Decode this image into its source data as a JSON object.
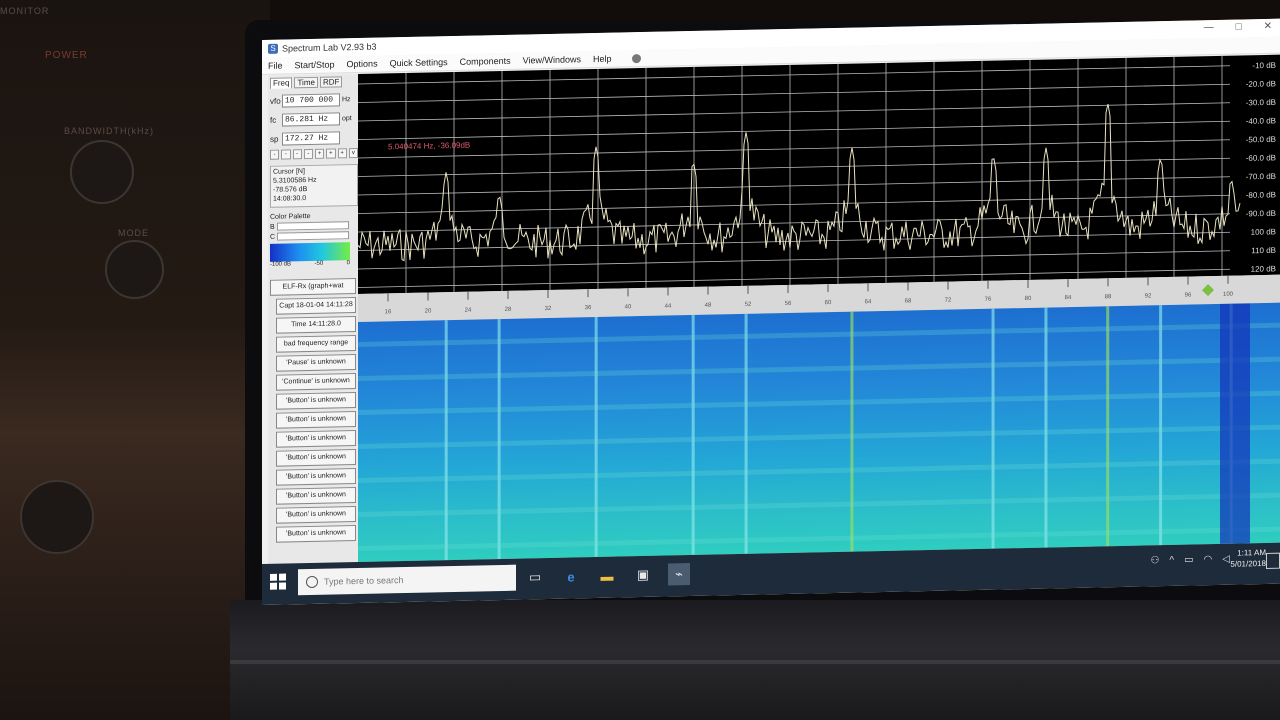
{
  "window": {
    "title": "Spectrum Lab V2.93 b3",
    "controls": [
      "—",
      "□",
      "✕"
    ]
  },
  "menu": [
    "File",
    "Start/Stop",
    "Options",
    "Quick Settings",
    "Components",
    "View/Windows",
    "Help"
  ],
  "panel": {
    "tabs": [
      "Freq",
      "Time",
      "RDF"
    ],
    "vfo": {
      "label": "vfo",
      "value": "10 700 000",
      "unit": "Hz"
    },
    "fc": {
      "label": "fc",
      "value": "86.281 Hz",
      "unit": "opt"
    },
    "sp": {
      "label": "sp",
      "value": "172.27 Hz"
    },
    "stepper": [
      "-",
      "-",
      "-",
      "-",
      "+",
      "+",
      "+",
      "v"
    ],
    "cursor_title": "Cursor [N]",
    "cursor_freq": "5.3100586 Hz",
    "cursor_db": "-78.576 dB",
    "cursor_time": "14:08:30.0",
    "palette_title": "Color Palette",
    "palette_b": "B",
    "palette_c": "C",
    "palette_scale": [
      "-100 dB",
      "-50",
      "0"
    ],
    "buttons": [
      "ELF-Rx (graph+wat",
      "Capt 18-01-04 14:11:28",
      "Time  14:11:28.0",
      "bad frequency range",
      "'Pause' is unknown",
      "'Continue' is unknown",
      "'Button' is unknown",
      "'Button' is unknown",
      "'Button' is unknown",
      "'Button' is unknown",
      "'Button' is unknown",
      "'Button' is unknown",
      "'Button' is unknown",
      "'Button' is unknown"
    ]
  },
  "graph": {
    "readout": "5.040474 Hz, -36.09dB",
    "db_labels": [
      "-10 dB",
      "-20.0 dB",
      "-30.0 dB",
      "-40.0 dB",
      "-50.0 dB",
      "-60.0 dB",
      "-70.0 dB",
      "-80.0 dB",
      "-90.0 dB",
      "100 dB",
      "110 dB",
      "120 dB"
    ],
    "peak_positions": [
      0.1,
      0.16,
      0.27,
      0.38,
      0.44,
      0.56,
      0.72,
      0.78,
      0.85,
      0.91,
      0.99
    ],
    "peak_heights": [
      0.45,
      0.55,
      0.35,
      0.42,
      0.3,
      0.38,
      0.42,
      0.4,
      0.2,
      0.45,
      0.55
    ]
  },
  "ruler": {
    "ticks": [
      "16",
      "20",
      "24",
      "28",
      "32",
      "36",
      "40",
      "44",
      "48",
      "52",
      "56",
      "60",
      "64",
      "68",
      "72",
      "76",
      "80",
      "84",
      "88",
      "92",
      "96",
      "100"
    ]
  },
  "taskbar": {
    "search_placeholder": "Type here to search",
    "time": "1:11 AM",
    "date": "5/01/2018"
  }
}
